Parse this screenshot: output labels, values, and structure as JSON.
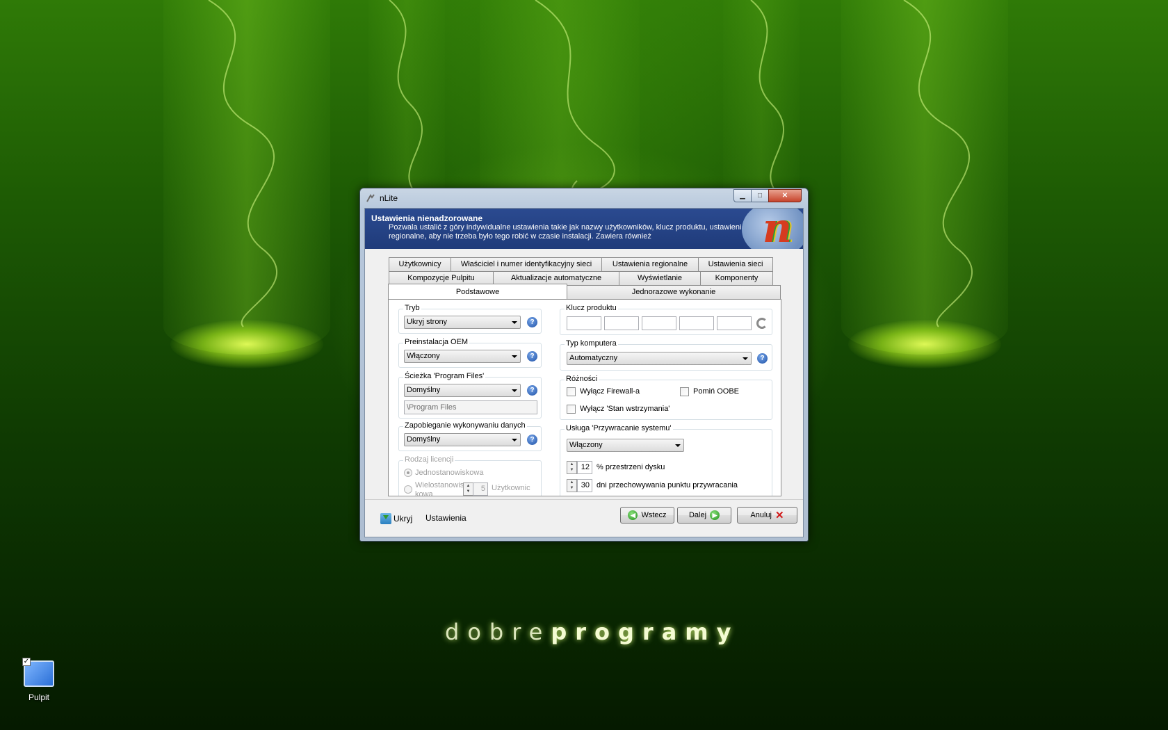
{
  "desktop": {
    "brand_light": "dobre",
    "brand_bold": "programy",
    "icon_label": "Pulpit"
  },
  "window": {
    "title": "nLite",
    "controls": {
      "minimize": "▁",
      "maximize": "□",
      "close": "✕"
    }
  },
  "banner": {
    "heading": "Ustawienia nienadzorowane",
    "description": "Pozwala ustalić z góry indywidualne ustawienia takie jak nazwy użytkowników, klucz produktu, ustawienia regionalne, aby nie trzeba było tego robić w czasie instalacji. Zawiera również"
  },
  "tabs": {
    "row1": [
      "Użytkownicy",
      "Właściciel i numer identyfikacyjny sieci",
      "Ustawienia regionalne",
      "Ustawienia sieci"
    ],
    "row2": [
      "Kompozycje Pulpitu",
      "Aktualizacje automatyczne",
      "Wyświetlanie",
      "Komponenty"
    ],
    "row3": [
      "Podstawowe",
      "Jednorazowe wykonanie"
    ],
    "active": "Podstawowe"
  },
  "left": {
    "tryb": {
      "title": "Tryb",
      "value": "Ukryj strony"
    },
    "oem": {
      "title": "Preinstalacja OEM",
      "value": "Włączony"
    },
    "program_files": {
      "title": "Ścieżka 'Program Files'",
      "value": "Domyślny",
      "path": "\\Program Files"
    },
    "dep": {
      "title": "Zapobieganie wykonywaniu danych",
      "value": "Domyślny"
    },
    "license": {
      "title": "Rodzaj licencji",
      "option1": "Jednostanowiskowa",
      "option2": "Wielostanowis kowa",
      "count": "5",
      "users_label": "Użytkownic"
    }
  },
  "right": {
    "product_key": {
      "title": "Klucz produktu",
      "fields": [
        "",
        "",
        "",
        "",
        ""
      ]
    },
    "computer_type": {
      "title": "Typ komputera",
      "value": "Automatyczny"
    },
    "misc": {
      "title": "Różności",
      "firewall": "Wyłącz Firewall-a",
      "skip_oobe": "Pomiń OOBE",
      "hibernate": "Wyłącz 'Stan wstrzymania'"
    },
    "restore": {
      "title": "Usługa 'Przywracanie systemu'",
      "value": "Włączony",
      "disk_percent": "12",
      "disk_label": "% przestrzeni dysku",
      "days": "30",
      "days_label": "dni przechowywania punktu przywracania"
    }
  },
  "footer": {
    "hide": "Ukryj",
    "settings": "Ustawienia",
    "back": "Wstecz",
    "next": "Dalej",
    "cancel": "Anuluj"
  },
  "colors": {
    "banner": "#1f3b7a",
    "help_icon": "#1c4fa5",
    "close_button": "#c7432b"
  }
}
